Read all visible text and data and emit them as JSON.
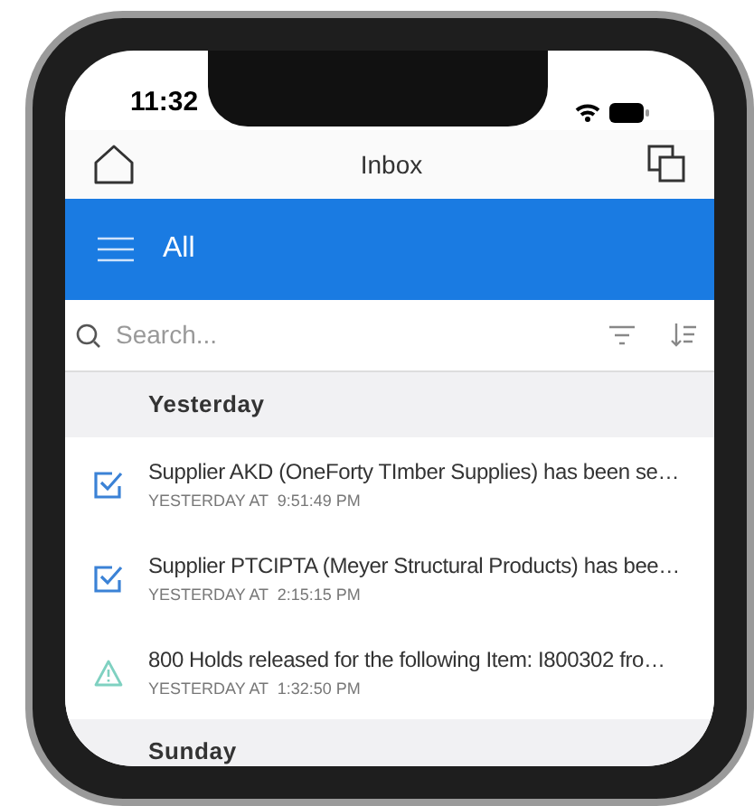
{
  "status_bar": {
    "time": "11:32"
  },
  "header": {
    "title": "Inbox"
  },
  "filter_bar": {
    "label": "All"
  },
  "search": {
    "placeholder": "Search..."
  },
  "sections": [
    {
      "title": "Yesterday",
      "items": [
        {
          "kind": "check",
          "text": "Supplier AKD (OneForty TImber Supplies) has been se…",
          "time": "YESTERDAY AT  9:51:49 PM",
          "color": "#3b82d6"
        },
        {
          "kind": "check",
          "text": "Supplier PTCIPTA (Meyer Structural Products) has bee…",
          "time": "YESTERDAY AT  2:15:15 PM",
          "color": "#3b82d6"
        },
        {
          "kind": "warning",
          "text": "800 Holds released for the following Item: I800302 fro…",
          "time": "YESTERDAY AT  1:32:50 PM",
          "color": "#7fd1c1"
        }
      ]
    },
    {
      "title": "Sunday"
    }
  ]
}
